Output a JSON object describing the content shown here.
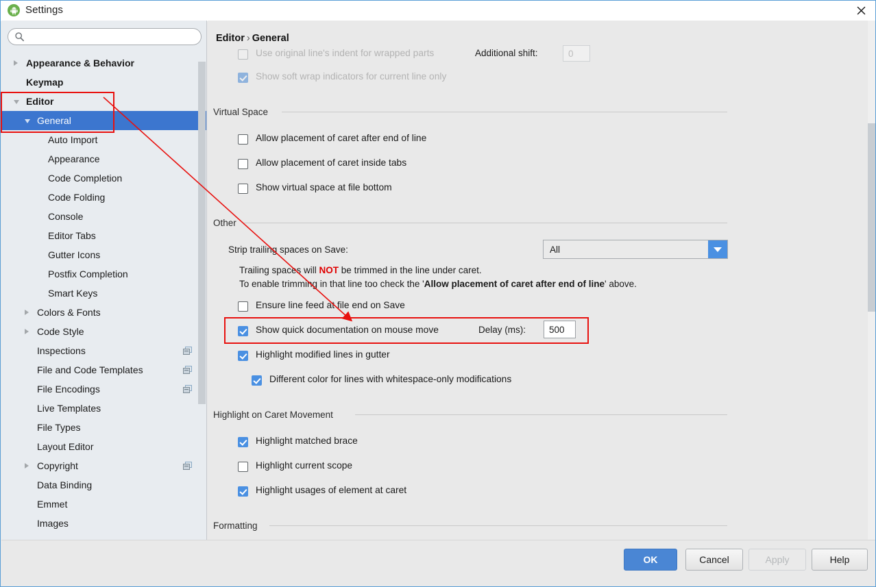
{
  "window": {
    "title": "Settings",
    "app_icon": "android-icon",
    "close_icon": "close-icon"
  },
  "sidebar": {
    "search": {
      "value": "",
      "placeholder": "",
      "icon": "search-icon"
    },
    "items": [
      {
        "label": "Appearance & Behavior",
        "level": 0,
        "arrow": "closed",
        "selected": false,
        "module_icon": false
      },
      {
        "label": "Keymap",
        "level": 0,
        "arrow": "none",
        "selected": false,
        "module_icon": false
      },
      {
        "label": "Editor",
        "level": 0,
        "arrow": "open",
        "selected": false,
        "module_icon": false
      },
      {
        "label": "General",
        "level": 1,
        "arrow": "open",
        "selected": true,
        "module_icon": false
      },
      {
        "label": "Auto Import",
        "level": 2,
        "arrow": "none",
        "selected": false,
        "module_icon": false
      },
      {
        "label": "Appearance",
        "level": 2,
        "arrow": "none",
        "selected": false,
        "module_icon": false
      },
      {
        "label": "Code Completion",
        "level": 2,
        "arrow": "none",
        "selected": false,
        "module_icon": false
      },
      {
        "label": "Code Folding",
        "level": 2,
        "arrow": "none",
        "selected": false,
        "module_icon": false
      },
      {
        "label": "Console",
        "level": 2,
        "arrow": "none",
        "selected": false,
        "module_icon": false
      },
      {
        "label": "Editor Tabs",
        "level": 2,
        "arrow": "none",
        "selected": false,
        "module_icon": false
      },
      {
        "label": "Gutter Icons",
        "level": 2,
        "arrow": "none",
        "selected": false,
        "module_icon": false
      },
      {
        "label": "Postfix Completion",
        "level": 2,
        "arrow": "none",
        "selected": false,
        "module_icon": false
      },
      {
        "label": "Smart Keys",
        "level": 2,
        "arrow": "none",
        "selected": false,
        "module_icon": false
      },
      {
        "label": "Colors & Fonts",
        "level": 1,
        "arrow": "closed",
        "selected": false,
        "module_icon": false
      },
      {
        "label": "Code Style",
        "level": 1,
        "arrow": "closed",
        "selected": false,
        "module_icon": false
      },
      {
        "label": "Inspections",
        "level": 1,
        "arrow": "none",
        "selected": false,
        "module_icon": true
      },
      {
        "label": "File and Code Templates",
        "level": 1,
        "arrow": "none",
        "selected": false,
        "module_icon": true
      },
      {
        "label": "File Encodings",
        "level": 1,
        "arrow": "none",
        "selected": false,
        "module_icon": true
      },
      {
        "label": "Live Templates",
        "level": 1,
        "arrow": "none",
        "selected": false,
        "module_icon": false
      },
      {
        "label": "File Types",
        "level": 1,
        "arrow": "none",
        "selected": false,
        "module_icon": false
      },
      {
        "label": "Layout Editor",
        "level": 1,
        "arrow": "none",
        "selected": false,
        "module_icon": false
      },
      {
        "label": "Copyright",
        "level": 1,
        "arrow": "closed",
        "selected": false,
        "module_icon": true
      },
      {
        "label": "Data Binding",
        "level": 1,
        "arrow": "none",
        "selected": false,
        "module_icon": false
      },
      {
        "label": "Emmet",
        "level": 1,
        "arrow": "none",
        "selected": false,
        "module_icon": false
      },
      {
        "label": "Images",
        "level": 1,
        "arrow": "none",
        "selected": false,
        "module_icon": false
      }
    ]
  },
  "content": {
    "breadcrumb": {
      "root": "Editor",
      "separator": "›",
      "leaf": "General"
    },
    "soft_wrap": {
      "use_original_indent_label": "Use original line's indent for wrapped parts",
      "additional_shift_label": "Additional shift:",
      "additional_shift_value": "0",
      "show_soft_wrap_label": "Show soft wrap indicators for current line only"
    },
    "virtual_space": {
      "header": "Virtual Space",
      "options": [
        {
          "label": "Allow placement of caret after end of line",
          "checked": false
        },
        {
          "label": "Allow placement of caret inside tabs",
          "checked": false
        },
        {
          "label": "Show virtual space at file bottom",
          "checked": false
        }
      ]
    },
    "other": {
      "header": "Other",
      "strip_label": "Strip trailing spaces on Save:",
      "strip_value": "All",
      "note_line1_a": "Trailing spaces will ",
      "note_line1_b": "NOT",
      "note_line1_c": " be trimmed in the line under caret.",
      "note_line2_a": "To enable trimming in that line too check the '",
      "note_line2_b": "Allow placement of caret after end of line",
      "note_line2_c": "' above.",
      "ensure_lf_label": "Ensure line feed at file end on Save",
      "ensure_lf_checked": false,
      "quick_doc_label": "Show quick documentation on mouse move",
      "quick_doc_checked": true,
      "delay_label": "Delay (ms):",
      "delay_value": "500",
      "highlight_modified_label": "Highlight modified lines in gutter",
      "highlight_modified_checked": true,
      "different_color_label": "Different color for lines with whitespace-only modifications",
      "different_color_checked": true
    },
    "caret_movement": {
      "header": "Highlight on Caret Movement",
      "options": [
        {
          "label": "Highlight matched brace",
          "checked": true
        },
        {
          "label": "Highlight current scope",
          "checked": false
        },
        {
          "label": "Highlight usages of element at caret",
          "checked": true
        }
      ]
    },
    "formatting": {
      "header": "Formatting"
    }
  },
  "footer": {
    "ok": "OK",
    "cancel": "Cancel",
    "apply": "Apply",
    "help": "Help"
  },
  "annotations": {
    "highlight_color": "#e8110f",
    "boxes": 2,
    "arrow": "pointer-arrow"
  },
  "colors": {
    "accent": "#4a90e2",
    "selection": "#3c76cf",
    "annotation": "#e8110f",
    "note_warning": "#e00000",
    "sidebar_bg": "#e8ecf0",
    "panel_bg": "#e9e9e9"
  }
}
